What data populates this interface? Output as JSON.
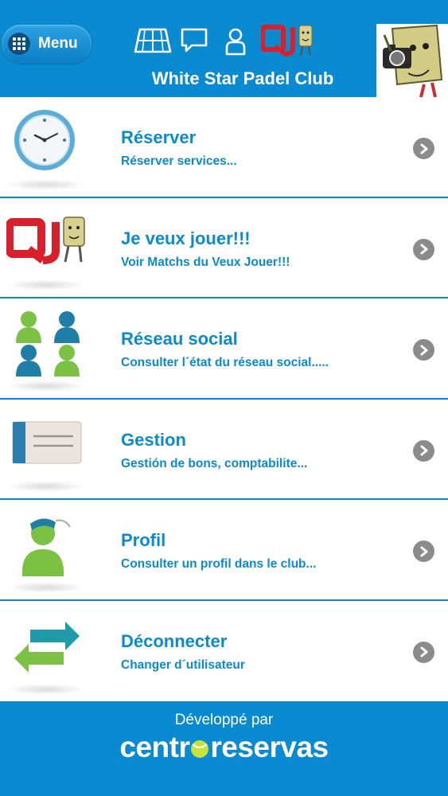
{
  "header": {
    "menu_label": "Menu",
    "title": "White Star Padel Club",
    "icons": [
      "court-icon",
      "chat-icon",
      "user-icon",
      "qj-logo-icon"
    ]
  },
  "items": [
    {
      "title": "Réserver",
      "subtitle": "Réserver services...",
      "icon": "clock-icon"
    },
    {
      "title": "Je veux jouer!!!",
      "subtitle": "Voir Matchs du Veux Jouer!!!",
      "icon": "qj-logo-icon"
    },
    {
      "title": "Réseau social",
      "subtitle": "Consulter l´état du réseau social.....",
      "icon": "people-group-icon"
    },
    {
      "title": "Gestion",
      "subtitle": "Gestión de bons, comptabilite...",
      "icon": "card-icon"
    },
    {
      "title": "Profil",
      "subtitle": "Consulter un profil dans le club...",
      "icon": "profile-person-icon"
    },
    {
      "title": "Déconnecter",
      "subtitle": "Changer d´utilisateur",
      "icon": "switch-arrows-icon"
    }
  ],
  "footer": {
    "developed_by": "Développé par",
    "brand_left": "centr",
    "brand_right": "reservas"
  },
  "colors": {
    "accent": "#0a8ad0",
    "chevron": "#8b8b8b"
  }
}
